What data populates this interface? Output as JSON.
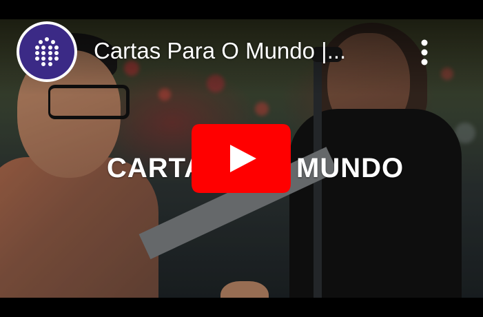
{
  "video": {
    "title": "Cartas Para O Mundo |...",
    "overlay_text_left": "CARTAS",
    "overlay_text_right": "MUNDO"
  },
  "channel": {
    "avatar_icon": "grid-dots-icon"
  },
  "controls": {
    "more_icon": "more-vertical-icon",
    "play_icon": "youtube-play-icon"
  },
  "colors": {
    "play_red": "#ff0000",
    "avatar_purple": "#3b2a86",
    "letterbox": "#000000"
  }
}
